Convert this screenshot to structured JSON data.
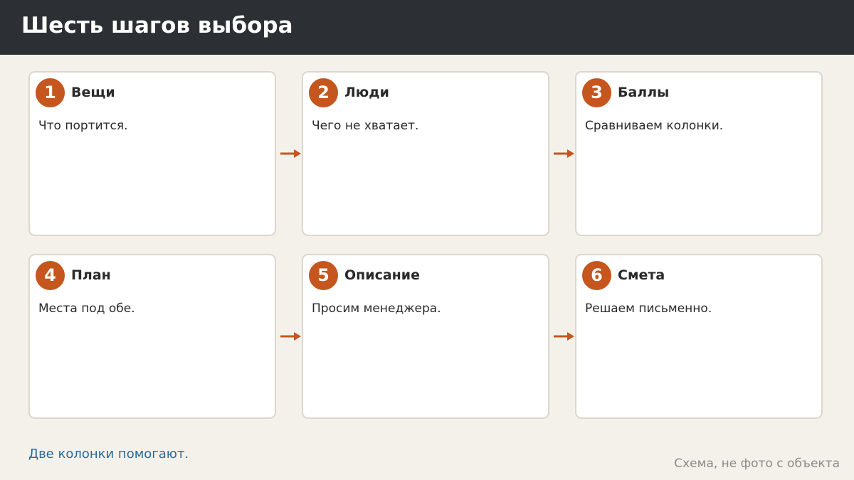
{
  "header": {
    "title": "Шесть шагов выбора"
  },
  "steps": [
    {
      "number": "1",
      "title": "Вещи",
      "text": "Что портится."
    },
    {
      "number": "2",
      "title": "Люди",
      "text": "Чего не хватает."
    },
    {
      "number": "3",
      "title": "Баллы",
      "text": "Сравниваем колонки."
    },
    {
      "number": "4",
      "title": "План",
      "text": "Места под обе."
    },
    {
      "number": "5",
      "title": "Описание",
      "text": "Просим менеджера."
    },
    {
      "number": "6",
      "title": "Смета",
      "text": "Решаем письменно."
    }
  ],
  "footer": {
    "note": "Две колонки помогают.",
    "caption": "Схема, не фото с объекта"
  },
  "colors": {
    "accent": "#c4561e",
    "header_bg": "#2c2f33",
    "page_bg": "#f4f1eb",
    "note_text": "#2b6a96"
  }
}
